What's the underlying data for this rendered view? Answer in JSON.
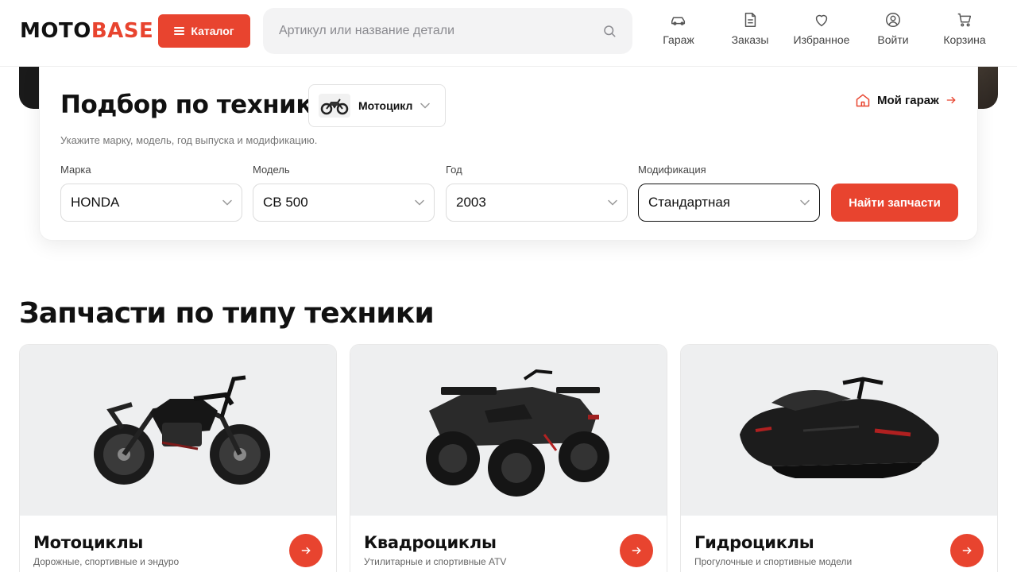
{
  "header": {
    "logo_part1": "MOTO",
    "logo_part2": "BASE",
    "catalog_label": "Каталог",
    "search_placeholder": "Артикул или название детали",
    "nav": {
      "garage": "Гараж",
      "orders": "Заказы",
      "favorites": "Избранное",
      "login": "Войти",
      "cart": "Корзина"
    }
  },
  "picker": {
    "title": "Подбор по технике",
    "vehicle_type": "Мотоцикл",
    "garage_link": "Мой гараж",
    "subtitle": "Укажите марку, модель, год выпуска и модификацию.",
    "fields": [
      {
        "label": "Марка",
        "value": "HONDA"
      },
      {
        "label": "Модель",
        "value": "CB 500"
      },
      {
        "label": "Год",
        "value": "2003"
      },
      {
        "label": "Модификация",
        "value": "Стандартная"
      }
    ],
    "find_button": "Найти запчасти"
  },
  "section": {
    "title": "Запчасти по типу техники",
    "cards": [
      {
        "title": "Мотоциклы",
        "subtitle": "Дорожные, спортивные и эндуро"
      },
      {
        "title": "Квадроциклы",
        "subtitle": "Утилитарные и спортивные ATV"
      },
      {
        "title": "Гидроциклы",
        "subtitle": "Прогулочные и спортивные модели"
      }
    ]
  },
  "colors": {
    "accent": "#e8442f",
    "text": "#111111",
    "muted": "#777777",
    "surface": "#f3f3f4"
  }
}
